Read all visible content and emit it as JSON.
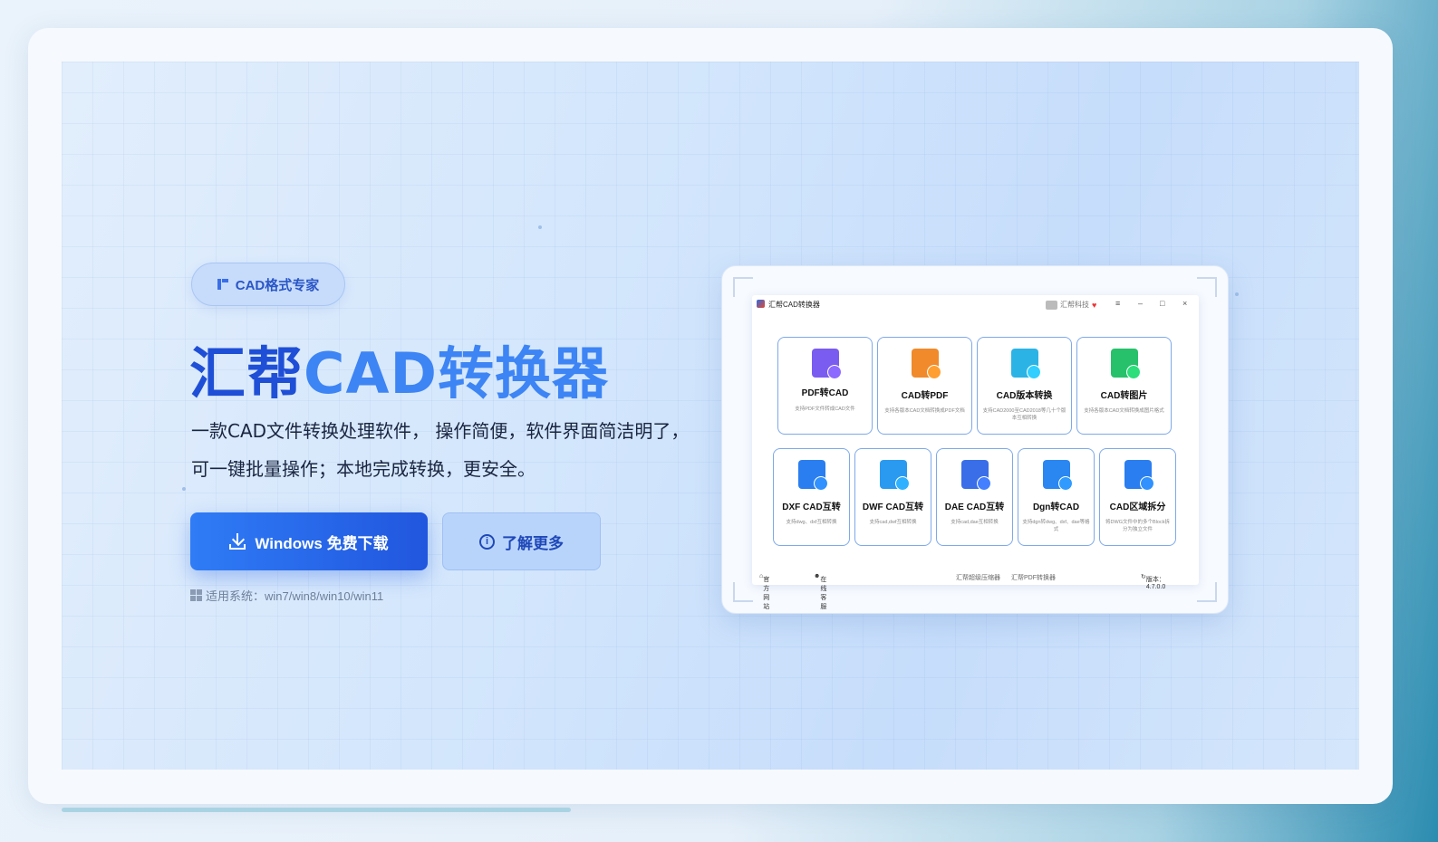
{
  "badge": {
    "label": "CAD格式专家"
  },
  "hero": {
    "title_part1": "汇帮",
    "title_part2": "CAD转换器",
    "description": "一款CAD文件转换处理软件， 操作简便，软件界面简洁明了，可一键批量操作；本地完成转换，更安全。"
  },
  "buttons": {
    "download_label": "Windows 免费下载",
    "learn_more_label": "了解更多"
  },
  "system": {
    "text": "适用系统：win7/win8/win10/win11"
  },
  "app": {
    "title": "汇帮CAD转换器",
    "company": "汇帮科技",
    "window_controls": [
      "≡",
      "–",
      "□",
      "×"
    ],
    "tiles_row1": [
      {
        "name": "PDF转CAD",
        "desc": "支持PDF文件转成CAD文件",
        "color": "#7a5cf0"
      },
      {
        "name": "CAD转PDF",
        "desc": "支持各版本CAD文档转换成PDF文档",
        "color": "#f08a2b"
      },
      {
        "name": "CAD版本转换",
        "desc": "支持CAD2000至CAD2018等几十个版本互相转换",
        "color": "#2bb3e6"
      },
      {
        "name": "CAD转图片",
        "desc": "支持各版本CAD文档转换成图片格式",
        "color": "#27c16b"
      }
    ],
    "tiles_row2": [
      {
        "name": "DXF CAD互转",
        "desc": "支持dwg、dxf互相转换",
        "color": "#2a7ef0"
      },
      {
        "name": "DWF CAD互转",
        "desc": "支持cad,dwf互相转换",
        "color": "#2a9af0"
      },
      {
        "name": "DAE CAD互转",
        "desc": "支持cad,dae互相转换",
        "color": "#3a6ee8"
      },
      {
        "name": "Dgn转CAD",
        "desc": "支持dgn转dwg、dxf、dae等格式",
        "color": "#2a86f0"
      },
      {
        "name": "CAD区域拆分",
        "desc": "将DWG文件中的多个Block拆分为独立文件",
        "color": "#2a7ef0"
      }
    ],
    "footer": {
      "website": "官方网站",
      "support": "在线客服",
      "link1": "汇帮超级压缩器",
      "link2": "汇帮PDF转换器",
      "version": "版本：4.7.0.0"
    }
  }
}
